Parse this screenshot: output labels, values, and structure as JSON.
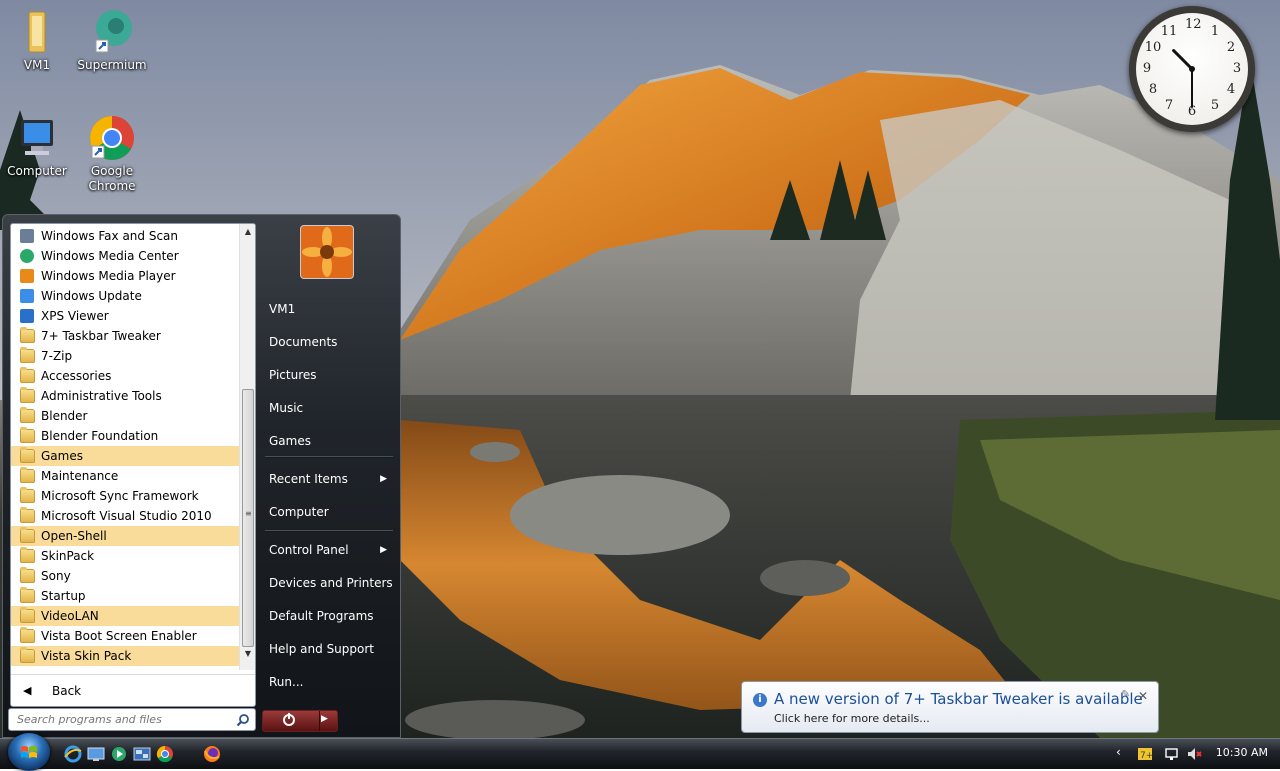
{
  "desktop": {
    "icons": [
      {
        "label": "VM1",
        "icon": "folder-icon"
      },
      {
        "label": "Supermium",
        "icon": "supermium-icon"
      },
      {
        "label": "Computer",
        "icon": "computer-icon"
      },
      {
        "label": "Google Chrome",
        "icon": "chrome-icon"
      }
    ]
  },
  "clock_gadget": {
    "hour": 10,
    "minute": 30,
    "numerals": [
      "12",
      "1",
      "2",
      "3",
      "4",
      "5",
      "6",
      "7",
      "8",
      "9",
      "10",
      "11"
    ]
  },
  "start_menu": {
    "programs": [
      {
        "label": "Windows Fax and Scan",
        "icon": "fax-icon",
        "highlight": false
      },
      {
        "label": "Windows Media Center",
        "icon": "media-center-icon",
        "highlight": false
      },
      {
        "label": "Windows Media Player",
        "icon": "media-player-icon",
        "highlight": false
      },
      {
        "label": "Windows Update",
        "icon": "windows-update-icon",
        "highlight": false
      },
      {
        "label": "XPS Viewer",
        "icon": "xps-viewer-icon",
        "highlight": false
      },
      {
        "label": "7+ Taskbar Tweaker",
        "icon": "folder-icon",
        "highlight": false
      },
      {
        "label": "7-Zip",
        "icon": "folder-icon",
        "highlight": false
      },
      {
        "label": "Accessories",
        "icon": "folder-icon",
        "highlight": false
      },
      {
        "label": "Administrative Tools",
        "icon": "folder-icon",
        "highlight": false
      },
      {
        "label": "Blender",
        "icon": "folder-icon",
        "highlight": false
      },
      {
        "label": "Blender Foundation",
        "icon": "folder-icon",
        "highlight": false
      },
      {
        "label": "Games",
        "icon": "folder-icon",
        "highlight": true
      },
      {
        "label": "Maintenance",
        "icon": "folder-icon",
        "highlight": false
      },
      {
        "label": "Microsoft Sync Framework",
        "icon": "folder-icon",
        "highlight": false
      },
      {
        "label": "Microsoft Visual Studio 2010",
        "icon": "folder-icon",
        "highlight": false
      },
      {
        "label": "Open-Shell",
        "icon": "folder-icon",
        "highlight": true
      },
      {
        "label": "SkinPack",
        "icon": "folder-icon",
        "highlight": false
      },
      {
        "label": "Sony",
        "icon": "folder-icon",
        "highlight": false
      },
      {
        "label": "Startup",
        "icon": "folder-icon",
        "highlight": false
      },
      {
        "label": "VideoLAN",
        "icon": "folder-icon",
        "highlight": true
      },
      {
        "label": "Vista Boot Screen Enabler",
        "icon": "folder-icon",
        "highlight": false
      },
      {
        "label": "Vista Skin Pack",
        "icon": "folder-icon",
        "highlight": true
      }
    ],
    "back_label": "Back",
    "search_placeholder": "Search programs and files",
    "right_items": [
      {
        "label": "VM1",
        "submenu": false
      },
      {
        "label": "Documents",
        "submenu": false
      },
      {
        "label": "Pictures",
        "submenu": false
      },
      {
        "label": "Music",
        "submenu": false
      },
      {
        "label": "Games",
        "submenu": false
      },
      {
        "label": "Recent Items",
        "submenu": true
      },
      {
        "label": "Computer",
        "submenu": false
      },
      {
        "label": "Control Panel",
        "submenu": true
      },
      {
        "label": "Devices and Printers",
        "submenu": false
      },
      {
        "label": "Default Programs",
        "submenu": false
      },
      {
        "label": "Help and Support",
        "submenu": false
      },
      {
        "label": "Run...",
        "submenu": false
      }
    ]
  },
  "notification": {
    "title": "A new version of 7+ Taskbar Tweaker is available",
    "body": "Click here for more details..."
  },
  "taskbar": {
    "pinned": [
      "internet-explorer-icon",
      "show-desktop-icon",
      "media-center-icon",
      "switcher-icon",
      "chrome-icon",
      "firefox-icon"
    ],
    "tray_icons": [
      "show-hidden-chevron-icon",
      "taskbar-tweaker-tray-icon",
      "network-icon",
      "volume-muted-icon"
    ],
    "time": "10:30 AM"
  },
  "colors": {
    "highlight": "#f9dc9a",
    "notification_title": "#1c4f9a"
  }
}
